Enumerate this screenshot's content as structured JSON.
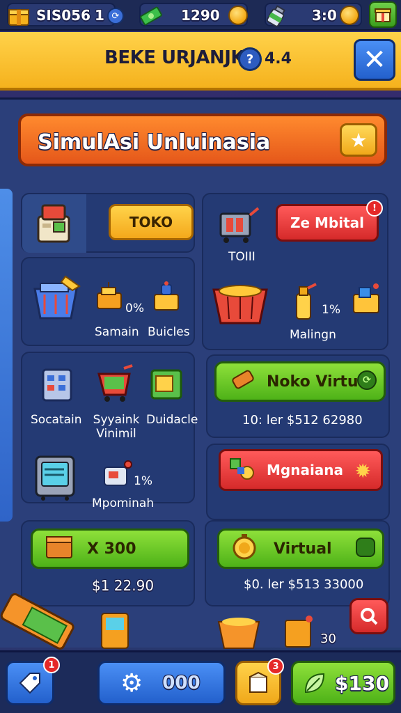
{
  "topbar": {
    "res1": {
      "value": "SIS056",
      "extra": "1",
      "icon": "gold-box-icon"
    },
    "res2": {
      "value": "1290",
      "icon": "cash-icon"
    },
    "res3": {
      "value": "3:0",
      "icon": "bottle-icon"
    },
    "gift_icon": "gift-icon"
  },
  "header": {
    "title": "BEKE URJANJKA",
    "badge": "?",
    "level": "4.4",
    "close_icon": "close-icon"
  },
  "panel": {
    "title": "SimulAsi Unluinasia",
    "star_icon": "star-icon"
  },
  "left": {
    "toko_button": "TOKO",
    "items_row1": [
      {
        "label": "Samain",
        "icon": "basket-icon"
      },
      {
        "label": "0%",
        "icon": "cash-register-icon"
      },
      {
        "label": "Buicles",
        "icon": "box-machine-icon"
      }
    ],
    "items_row2": [
      {
        "label": "Socatain",
        "icon": "building-icon"
      },
      {
        "label": "Syyaink Vinimil",
        "icon": "cart-icon"
      },
      {
        "label": "Duidacle",
        "icon": "green-box-icon"
      }
    ],
    "items_row3": [
      {
        "label": "",
        "icon": "machine-icon"
      },
      {
        "label": "Mpominah",
        "icon": "device-icon"
      },
      {
        "label": "1%",
        "icon": ""
      }
    ],
    "buy_button": {
      "label": "X 300",
      "icon": "crate-icon"
    },
    "price": "$1 22.90"
  },
  "right": {
    "tab_label": "TOIII",
    "ze_button": "Ze Mbital",
    "ze_badge": "!",
    "items": [
      {
        "label": "",
        "icon": "basket-full-icon"
      },
      {
        "label": "Malingn",
        "icon": "spray-icon"
      },
      {
        "label": "1%",
        "icon": ""
      }
    ],
    "virtual_button": "Noko Virtuel",
    "virtual_stat": "10: ler $512 62980",
    "mgn_button": "Mgnaiana",
    "virtual2_button": "Virtual",
    "virtual2_stat": "$0. ler $513 33000"
  },
  "bottom": {
    "left_badge": "1",
    "settings_value": "000",
    "mid_badge": "3",
    "cash_value": "$130",
    "scene_text": "30"
  },
  "colors": {
    "accent_yellow": "#f5b21d",
    "accent_orange": "#e5571a",
    "accent_green": "#4eb218",
    "accent_red": "#d52a2a",
    "panel_blue": "#2b3f7a"
  }
}
